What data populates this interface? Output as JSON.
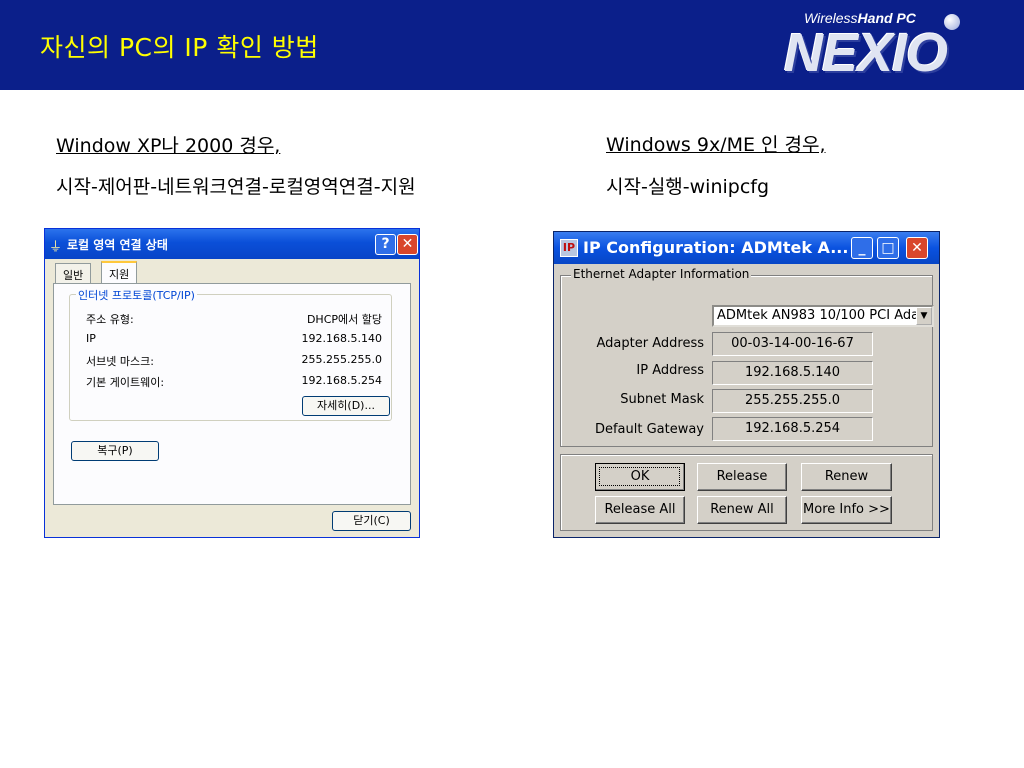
{
  "slide": {
    "title": "자신의 PC의 IP 확인 방법",
    "logo": {
      "tagline_light": "Wireless",
      "tagline_bold": "Hand PC",
      "wordmark": "NEXIO"
    },
    "left_heading": "Window XP나 2000 경우,",
    "left_path": "시작-제어판-네트워크연결-로컬영역연결-지원",
    "right_heading": "Windows 9x/ME 인 경우,",
    "right_path": "시작-실행-winipcfg"
  },
  "xp_dialog": {
    "title_icon": "network-connection-icon",
    "title": "로컬 영역 연결 상태",
    "help_glyph": "?",
    "close_glyph": "✕",
    "tabs": [
      {
        "label": "일반",
        "active": false
      },
      {
        "label": "지원",
        "active": true
      }
    ],
    "group_label": "인터넷 프로토콜(TCP/IP)",
    "rows": [
      {
        "label": "주소 유형:",
        "value": "DHCP에서 할당"
      },
      {
        "label": "IP",
        "value": "192.168.5.140"
      },
      {
        "label": "서브넷 마스크:",
        "value": "255.255.255.0"
      },
      {
        "label": "기본 게이트웨이:",
        "value": "192.168.5.254"
      }
    ],
    "details_button": "자세히(D)...",
    "repair_button": "복구(P)",
    "close_button": "닫기(C)"
  },
  "ipconfig_dialog": {
    "title_icon": "ip-config-icon",
    "title": "IP Configuration: ADMtek A...",
    "minimize_glyph": "_",
    "maximize_glyph": "□",
    "close_glyph": "✕",
    "group_label": "Ethernet  Adapter Information",
    "adapter_select": "ADMtek AN983 10/100 PCI Ada",
    "fields": [
      {
        "label": "Adapter Address",
        "value": "00-03-14-00-16-67"
      },
      {
        "label": "IP Address",
        "value": "192.168.5.140"
      },
      {
        "label": "Subnet Mask",
        "value": "255.255.255.0"
      },
      {
        "label": "Default Gateway",
        "value": "192.168.5.254"
      }
    ],
    "buttons": {
      "ok": "OK",
      "release": "Release",
      "renew": "Renew",
      "release_all": "Release All",
      "renew_all": "Renew All",
      "more_info": "More Info >>"
    }
  }
}
